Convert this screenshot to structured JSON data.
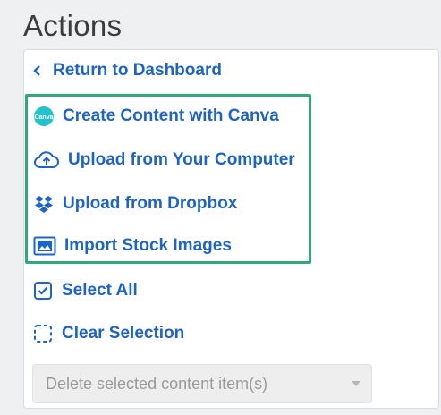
{
  "heading": "Actions",
  "items": [
    {
      "label": "Return to Dashboard",
      "icon": "chevron-left-icon"
    },
    {
      "label": "Create Content with Canva",
      "icon": "canva-icon"
    },
    {
      "label": "Upload from Your Computer",
      "icon": "cloud-upload-icon"
    },
    {
      "label": "Upload from Dropbox",
      "icon": "dropbox-icon"
    },
    {
      "label": "Import Stock Images",
      "icon": "image-icon"
    },
    {
      "label": "Select All",
      "icon": "checkbox-checked-icon"
    },
    {
      "label": "Clear Selection",
      "icon": "dashed-square-icon"
    }
  ],
  "bulk_action": {
    "selected": "Delete selected content item(s)"
  },
  "colors": {
    "link": "#1e63c7",
    "highlight": "#2fa87a",
    "canva": "#24c2cc"
  }
}
